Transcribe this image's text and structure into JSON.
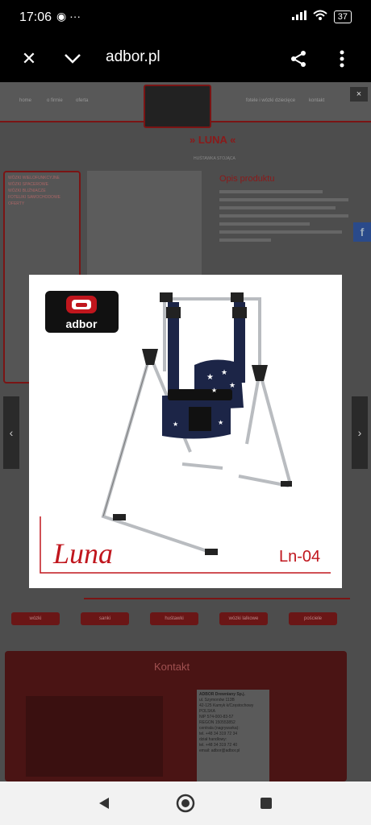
{
  "status_bar": {
    "time": "17:06",
    "notif_icons": "◉ ···",
    "battery": "37"
  },
  "browser": {
    "url": "adbor.pl",
    "close_glyph": "✕",
    "chevron_glyph": "⌄",
    "share_glyph": "⋖",
    "menu_glyph": "⋮"
  },
  "site": {
    "nav_left": [
      "home",
      "o firmie",
      "oferta"
    ],
    "nav_right": [
      "fotele i wózki dziecięce",
      "kontakt"
    ],
    "logo_text": "adbor",
    "product_title": "» LUNA «",
    "breadcrumb": "HUŚTAWKA STOJĄCA",
    "desc_title": "Opis produktu",
    "sidebar_items": [
      "WÓZKI WIELOFUNKCYJNE",
      "WÓZKI SPACEROWE",
      "WÓZKI BLIŹNIACZE",
      "FOTELIKI SAMOCHODOWE",
      "OFERTY"
    ],
    "bottom_tabs": [
      "wózki",
      "sanki",
      "huśtawki",
      "wózki lalkowe",
      "pościele"
    ],
    "contact_title": "Kontakt",
    "contact_card": [
      "ADBOR Drewniany Sp.j.",
      "ul. Szymonów 113B",
      "42-125 Kamyk k/Częstochowy",
      "POLSKA",
      "NIP 574-000-83-57",
      "REGON 150553852",
      "centrala (nagrywarka):",
      "tel. +48 34 319 72 34",
      "dział handlowy:",
      "tel. +48 34 319 72 40",
      "email: adbor@adbor.pl"
    ],
    "close_label": "×",
    "prev_arrow": "‹",
    "next_arrow": "›",
    "fb_label": "f"
  },
  "lightbox": {
    "brand_logo": "adbor",
    "product_script": "Luna",
    "model_code": "Ln-04"
  },
  "colors": {
    "brand_red": "#c0161d",
    "navy": "#1c2547",
    "frame_gray": "#b9bcc0"
  }
}
